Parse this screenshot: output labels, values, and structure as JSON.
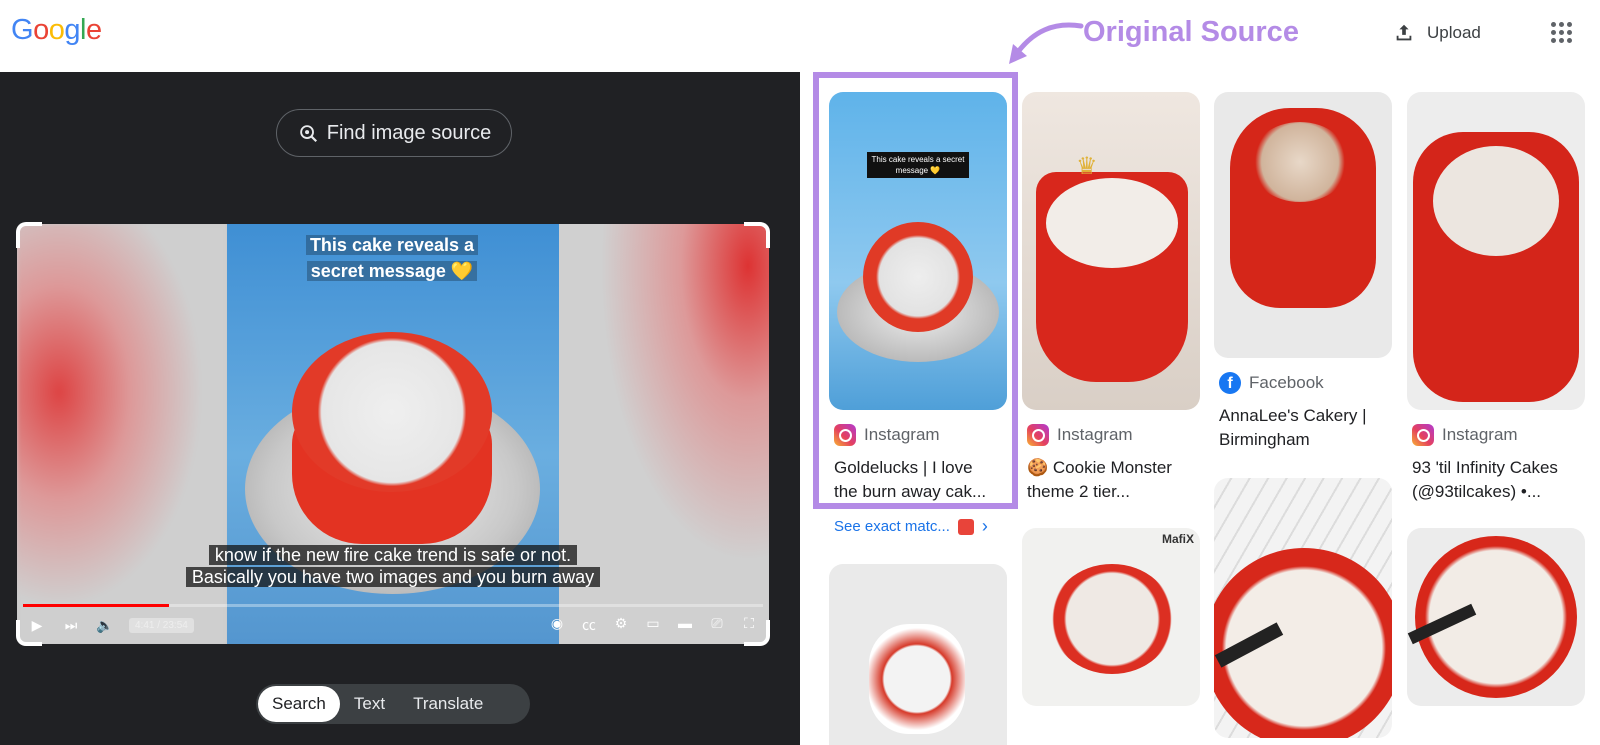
{
  "header": {
    "logo_letters": [
      {
        "ch": "G",
        "color": "#4285F4"
      },
      {
        "ch": "o",
        "color": "#EA4335"
      },
      {
        "ch": "o",
        "color": "#FBBC05"
      },
      {
        "ch": "g",
        "color": "#4285F4"
      },
      {
        "ch": "l",
        "color": "#34A853"
      },
      {
        "ch": "e",
        "color": "#EA4335"
      }
    ],
    "upload_label": "Upload",
    "apps_icon": "apps-grid-icon"
  },
  "annotation": {
    "label": "Original Source",
    "color": "#b48be6"
  },
  "left_panel": {
    "find_source_label": "Find image source",
    "video": {
      "caption_top_line1": "This cake reveals a",
      "caption_top_line2": "secret message 💛",
      "subtitle_line1": "know if the new fire cake trend is safe or not.",
      "subtitle_line2": "Basically you have two images and you burn away",
      "time": "4:41 / 23:54",
      "progress_percent": 19.7
    },
    "tabs": [
      {
        "label": "Search",
        "active": true
      },
      {
        "label": "Text",
        "active": false
      },
      {
        "label": "Translate",
        "active": false
      }
    ]
  },
  "results": {
    "col1": [
      {
        "source": "Instagram",
        "source_type": "instagram",
        "title_line1": "Goldelucks | I love",
        "title_line2": "the burn away cak...",
        "thumb_caption": "This cake reveals a secret message 💛"
      }
    ],
    "see_exact_label": "See exact matc...",
    "col2": [
      {
        "source": "Instagram",
        "source_type": "instagram",
        "title_line1": "🍪 Cookie Monster",
        "title_line2": "theme 2 tier..."
      },
      {
        "watermark": "MafiX"
      }
    ],
    "col3": [
      {
        "source": "Facebook",
        "source_type": "facebook",
        "title_line1": "AnnaLee's Cakery |",
        "title_line2": "Birmingham"
      }
    ],
    "col4": [
      {
        "source": "Instagram",
        "source_type": "instagram",
        "title_line1": "93 'til Infinity Cakes",
        "title_line2": "(@93tilcakes) •..."
      }
    ]
  }
}
